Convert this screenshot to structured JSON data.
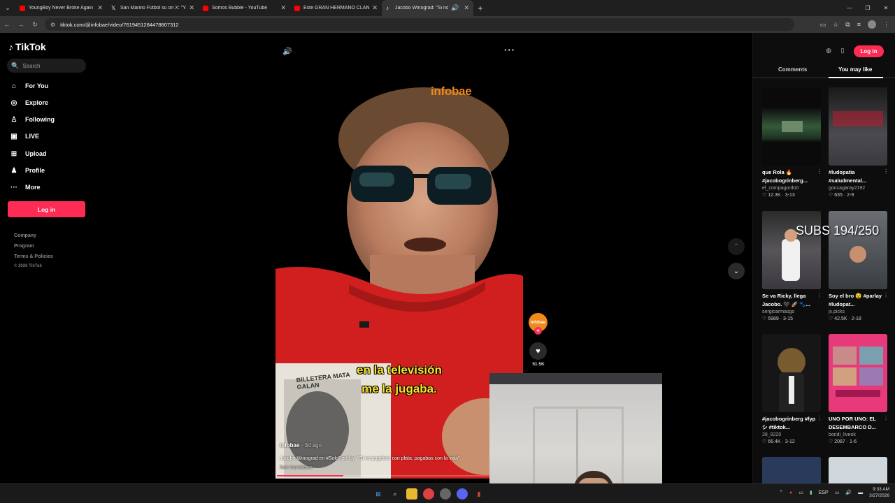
{
  "browser": {
    "tabs": [
      {
        "title": "YoungBoy Never Broke Again -",
        "favicon_color": "#ff0000"
      },
      {
        "title": "San Marino Fútbol su on X: \"Ya",
        "favicon_color": "#ffffff"
      },
      {
        "title": "Somos Bubble - YouTube",
        "favicon_color": "#ff0000"
      },
      {
        "title": "Este GRAN HERMANO CLANDE",
        "favicon_color": "#ff0000"
      },
      {
        "title": "Jacobo Winograd: \"Si no pa",
        "favicon_color": "#ffffff"
      }
    ],
    "url": "tiktok.com/@infobae/video/7619451284478807312"
  },
  "sidebar": {
    "logo": "TikTok",
    "search_placeholder": "Search",
    "nav": [
      {
        "label": "For You",
        "icon": "home-icon"
      },
      {
        "label": "Explore",
        "icon": "compass-icon"
      },
      {
        "label": "Following",
        "icon": "following-icon"
      },
      {
        "label": "LIVE",
        "icon": "live-icon"
      },
      {
        "label": "Upload",
        "icon": "upload-icon"
      },
      {
        "label": "Profile",
        "icon": "profile-icon"
      },
      {
        "label": "More",
        "icon": "more-icon"
      }
    ],
    "login_label": "Log in",
    "footer": [
      "Company",
      "Program",
      "Terms & Policies"
    ],
    "copyright": "© 2026 TikTok"
  },
  "video": {
    "watermark": "infobae",
    "subtitle_line1": "en la televisión",
    "subtitle_line2": "me la jugaba.",
    "shirt_text": "BILLETERA MATA GALAN",
    "author": "infobae",
    "age": "· 3d ago",
    "description": "Jacobo Winograd en #SoloPorHoy: \"Si no pagabas con plata, pagabas con la vida\"",
    "see_translation": "See translation",
    "likes": "51.5K",
    "avatar_label": "infobae",
    "progress": 0.27
  },
  "right_panel": {
    "login_label": "Log in",
    "tabs": [
      "Comments",
      "You may like"
    ],
    "active_tab": 1,
    "cards": [
      {
        "title": "que Rola 🔥 #jacobogrinberg...",
        "user": "el_compagordo0",
        "likes": "12.3K",
        "date": "3-13",
        "thumb": "#1a2a1c"
      },
      {
        "title": "#ludopatia #saludmental...",
        "user": "gonzagaray2192",
        "likes": "635",
        "date": "2-9",
        "thumb": "#2a2a2e"
      },
      {
        "title": "Se va Ricky, llega Jacobo. 🖤 🚀 🐾...",
        "user": "sergioarmasgo",
        "likes": "5989",
        "date": "3-15",
        "thumb": "#3c3a3e"
      },
      {
        "title": "Soy el bro 😵 #parlay #ludopat...",
        "user": "jx.picks",
        "likes": "42.5K",
        "date": "2-18",
        "thumb": "#4a4d52"
      },
      {
        "title": "#jacobogrinberg #fyp シ #tiktok...",
        "user": "28_8220",
        "likes": "66.4K",
        "date": "3-12",
        "thumb": "#161616"
      },
      {
        "title": "UNO POR UNO: EL DESEMBARCO D...",
        "user": "bondi_liveok",
        "likes": "2087",
        "date": "1-6",
        "thumb": "#e83a7a"
      }
    ]
  },
  "overlay_text": "SUBS 194/250",
  "taskbar": {
    "lang": "ESP",
    "time": "9:33 AM",
    "date": "3/27/2026"
  }
}
